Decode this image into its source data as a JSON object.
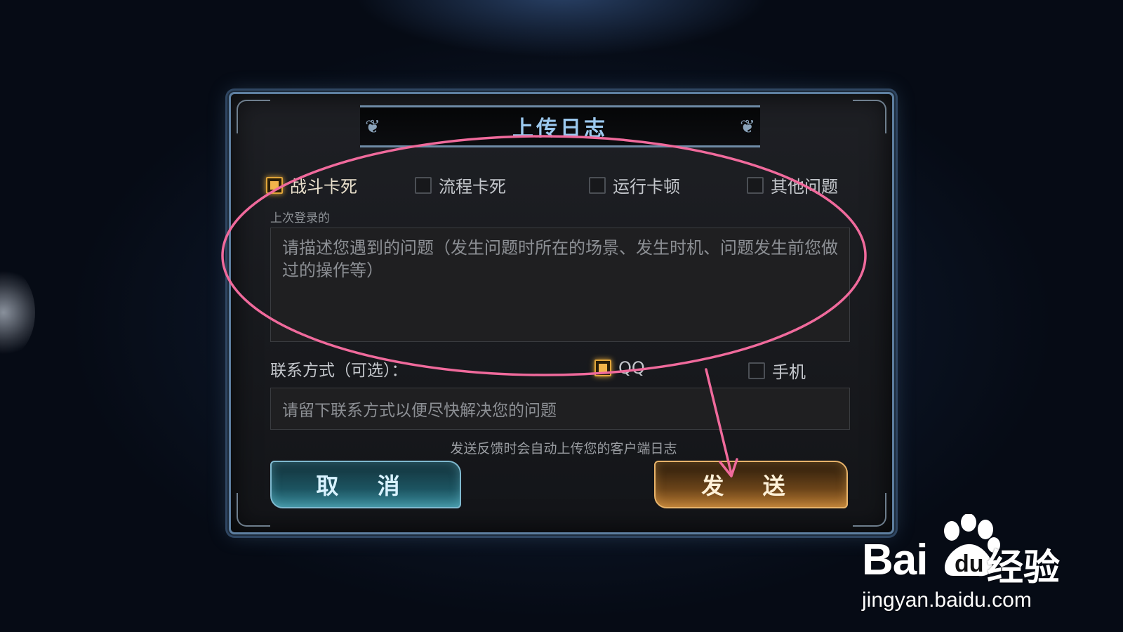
{
  "dialog": {
    "title": "上传日志",
    "issue_types": [
      {
        "label": "战斗卡死",
        "checked": true
      },
      {
        "label": "流程卡死",
        "checked": false
      },
      {
        "label": "运行卡顿",
        "checked": false
      },
      {
        "label": "其他问题",
        "checked": false
      }
    ],
    "last_login_label": "上次登录的",
    "description": {
      "placeholder": "请描述您遇到的问题（发生问题时所在的场景、发生时机、问题发生前您做过的操作等）"
    },
    "contact": {
      "label": "联系方式（可选）：",
      "options": [
        {
          "label": "QQ",
          "checked": true
        },
        {
          "label": "手机",
          "checked": false
        }
      ],
      "placeholder": "请留下联系方式以便尽快解决您的问题"
    },
    "notice": "发送反馈时会自动上传您的客户端日志",
    "cancel_label": "取 消",
    "send_label": "发 送"
  },
  "annotation": {
    "color": "#f06a9c"
  },
  "watermark": {
    "brand": "Bai",
    "brand_du": "du",
    "product": "经验",
    "url": "jingyan.baidu.com"
  },
  "colors": {
    "title_text": "#9cc9ef",
    "checkbox_checked": "#f2b44a",
    "cancel_button": "#1c5461",
    "send_button": "#b77a33"
  }
}
